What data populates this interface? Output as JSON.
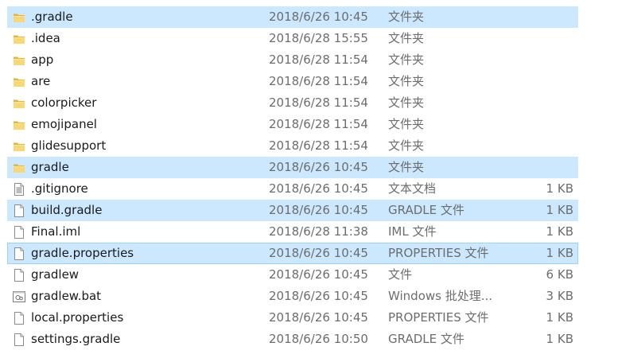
{
  "files": [
    {
      "name": ".gradle",
      "date": "2018/6/26 10:45",
      "type": "文件夹",
      "size": "",
      "icon": "folder-icon",
      "selected": true,
      "focused": false
    },
    {
      "name": ".idea",
      "date": "2018/6/28 15:55",
      "type": "文件夹",
      "size": "",
      "icon": "folder-icon",
      "selected": false,
      "focused": false
    },
    {
      "name": "app",
      "date": "2018/6/28 11:54",
      "type": "文件夹",
      "size": "",
      "icon": "folder-icon",
      "selected": false,
      "focused": false
    },
    {
      "name": "are",
      "date": "2018/6/28 11:54",
      "type": "文件夹",
      "size": "",
      "icon": "folder-icon",
      "selected": false,
      "focused": false
    },
    {
      "name": "colorpicker",
      "date": "2018/6/28 11:54",
      "type": "文件夹",
      "size": "",
      "icon": "folder-icon",
      "selected": false,
      "focused": false
    },
    {
      "name": "emojipanel",
      "date": "2018/6/28 11:54",
      "type": "文件夹",
      "size": "",
      "icon": "folder-icon",
      "selected": false,
      "focused": false
    },
    {
      "name": "glidesupport",
      "date": "2018/6/28 11:54",
      "type": "文件夹",
      "size": "",
      "icon": "folder-icon",
      "selected": false,
      "focused": false
    },
    {
      "name": "gradle",
      "date": "2018/6/26 10:45",
      "type": "文件夹",
      "size": "",
      "icon": "folder-icon",
      "selected": true,
      "focused": false
    },
    {
      "name": ".gitignore",
      "date": "2018/6/26 10:45",
      "type": "文本文档",
      "size": "1 KB",
      "icon": "text-document-icon",
      "selected": false,
      "focused": false
    },
    {
      "name": "build.gradle",
      "date": "2018/6/26 10:45",
      "type": "GRADLE 文件",
      "size": "1 KB",
      "icon": "file-icon",
      "selected": true,
      "focused": false
    },
    {
      "name": "Final.iml",
      "date": "2018/6/28 11:38",
      "type": "IML 文件",
      "size": "1 KB",
      "icon": "file-icon",
      "selected": false,
      "focused": false
    },
    {
      "name": "gradle.properties",
      "date": "2018/6/26 10:45",
      "type": "PROPERTIES 文件",
      "size": "1 KB",
      "icon": "file-icon",
      "selected": true,
      "focused": true
    },
    {
      "name": "gradlew",
      "date": "2018/6/26 10:45",
      "type": "文件",
      "size": "6 KB",
      "icon": "file-icon",
      "selected": false,
      "focused": false
    },
    {
      "name": "gradlew.bat",
      "date": "2018/6/26 10:45",
      "type": "Windows 批处理...",
      "size": "3 KB",
      "icon": "batch-file-icon",
      "selected": false,
      "focused": false
    },
    {
      "name": "local.properties",
      "date": "2018/6/26 10:45",
      "type": "PROPERTIES 文件",
      "size": "1 KB",
      "icon": "file-icon",
      "selected": false,
      "focused": false
    },
    {
      "name": "settings.gradle",
      "date": "2018/6/26 10:50",
      "type": "GRADLE 文件",
      "size": "1 KB",
      "icon": "file-icon",
      "selected": false,
      "focused": false
    }
  ],
  "colors": {
    "selection_bg": "#cce8ff",
    "focus_border": "#99d1ff",
    "folder_yellow": "#f8d775",
    "secondary_text": "#6d6d6d"
  }
}
